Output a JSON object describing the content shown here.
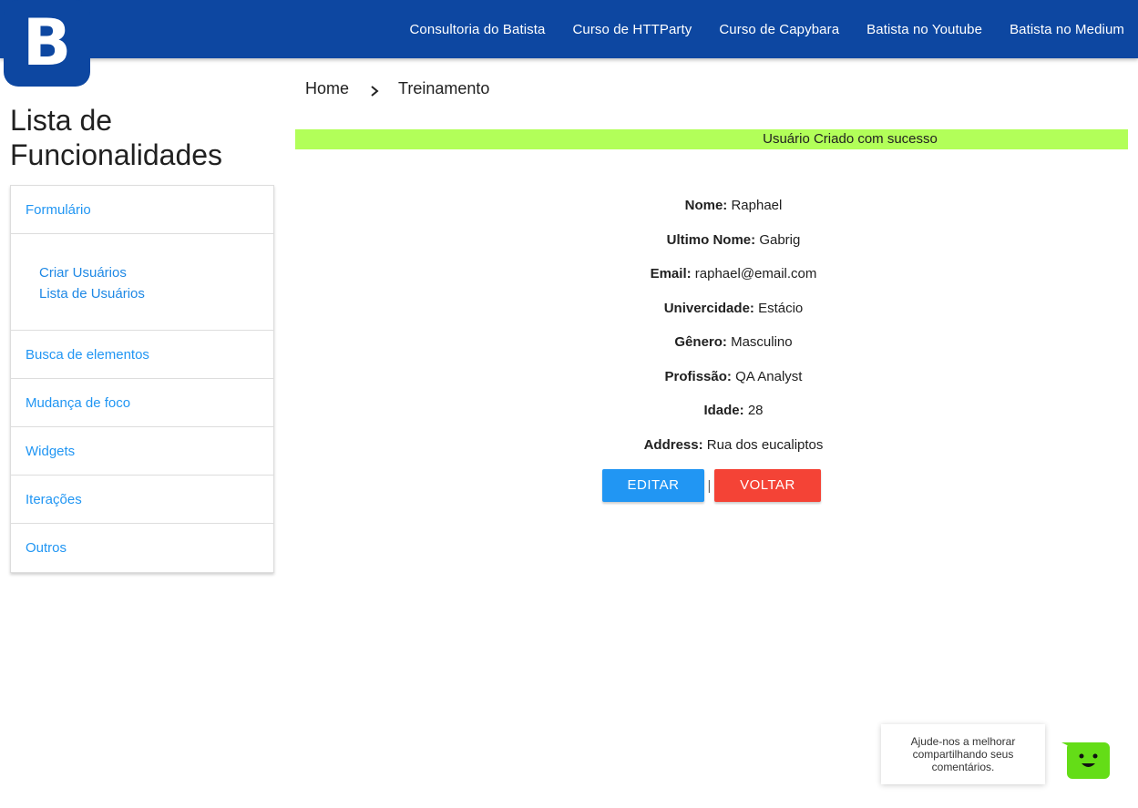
{
  "brand": {
    "logo_letter": "B",
    "colors": {
      "primary": "#0d47a1",
      "link": "#2196f3",
      "banner": "#b2ff59",
      "edit": "#2196f3",
      "back": "#f44336",
      "bot": "#64dd17"
    }
  },
  "nav": {
    "items": [
      {
        "label": "Consultoria do Batista"
      },
      {
        "label": "Curso de HTTParty"
      },
      {
        "label": "Curso de Capybara"
      },
      {
        "label": "Batista no Youtube"
      },
      {
        "label": "Batista no Medium"
      }
    ]
  },
  "sidebar": {
    "title": "Lista de Funcionalidades",
    "items": [
      {
        "label": "Formulário"
      },
      {
        "label": "Busca de elementos"
      },
      {
        "label": "Mudança de foco"
      },
      {
        "label": "Widgets"
      },
      {
        "label": "Iterações"
      },
      {
        "label": "Outros"
      }
    ],
    "sub_items": [
      {
        "label": "Criar Usuários"
      },
      {
        "label": "Lista de Usuários"
      }
    ]
  },
  "breadcrumb": {
    "home": "Home",
    "current": "Treinamento",
    "separator_icon": "chevron-right-icon"
  },
  "banner": {
    "message": "Usuário Criado com sucesso"
  },
  "details": [
    {
      "label": "Nome:",
      "value": "Raphael"
    },
    {
      "label": "Ultimo Nome:",
      "value": "Gabrig"
    },
    {
      "label": "Email:",
      "value": "raphael@email.com"
    },
    {
      "label": "Univercidade:",
      "value": "Estácio"
    },
    {
      "label": "Gênero:",
      "value": "Masculino"
    },
    {
      "label": "Profissão:",
      "value": "QA Analyst"
    },
    {
      "label": "Idade:",
      "value": "28"
    },
    {
      "label": "Address:",
      "value": "Rua dos eucaliptos"
    }
  ],
  "actions": {
    "edit_label": "EDITAR",
    "separator": "|",
    "back_label": "VOLTAR"
  },
  "feedback": {
    "line1": "Ajude-nos a melhorar",
    "line2": "compartilhando seus",
    "line3": "comentários.",
    "bot_icon": "smiley-bot-icon"
  }
}
